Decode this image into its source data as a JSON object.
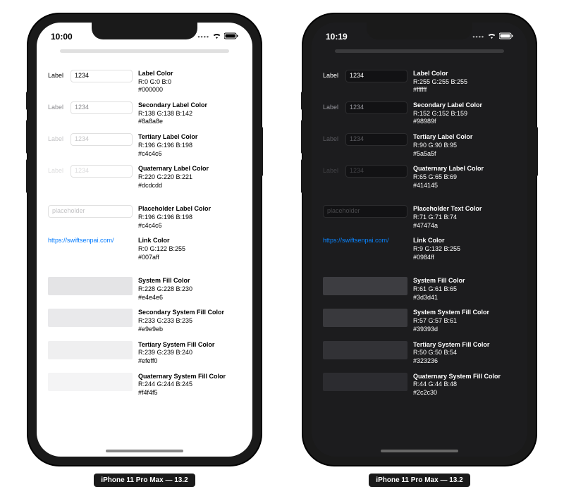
{
  "caption": "iPhone 11 Pro Max — 13.2",
  "link_url": "https://swiftsenpai.com/",
  "light": {
    "time": "10:00",
    "label_text": "Label",
    "field_value": "1234",
    "placeholder": "placeholder",
    "rows": [
      {
        "name": "Label Color",
        "rgb": "R:0 G:0 B:0",
        "hex": "#000000",
        "color": "#000000"
      },
      {
        "name": "Secondary Label Color",
        "rgb": "R:138 G:138 B:142",
        "hex": "#8a8a8e",
        "color": "#8a8a8e"
      },
      {
        "name": "Tertiary Label Color",
        "rgb": "R:196 G:196 B:198",
        "hex": "#c4c4c6",
        "color": "#c4c4c6"
      },
      {
        "name": "Quaternary Label Color",
        "rgb": "R:220 G:220 B:221",
        "hex": "#dcdcdd",
        "color": "#dcdcdd"
      }
    ],
    "placeholder_row": {
      "name": "Placeholder Label Color",
      "rgb": "R:196 G:196 B:198",
      "hex": "#c4c4c6",
      "color": "#c4c4c6"
    },
    "link_row": {
      "name": "Link Color",
      "rgb": "R:0 G:122 B:255",
      "hex": "#007aff",
      "color": "#007aff"
    },
    "fills": [
      {
        "name": "System Fill Color",
        "rgb": "R:228 G:228 B:230",
        "hex": "#e4e4e6",
        "color": "#e4e4e6"
      },
      {
        "name": "Secondary System Fill Color",
        "rgb": "R:233 G:233 B:235",
        "hex": "#e9e9eb",
        "color": "#e9e9eb"
      },
      {
        "name": "Tertiary System Fill Color",
        "rgb": "R:239 G:239 B:240",
        "hex": "#efeff0",
        "color": "#efeff0"
      },
      {
        "name": "Quaternary System Fill Color",
        "rgb": "R:244 G:244 B:245",
        "hex": "#f4f4f5",
        "color": "#f4f4f5"
      }
    ]
  },
  "dark": {
    "time": "10:19",
    "label_text": "Label",
    "field_value": "1234",
    "placeholder": "placeholder",
    "rows": [
      {
        "name": "Label Color",
        "rgb": "R:255 G:255 B:255",
        "hex": "#ffffff",
        "color": "#ffffff"
      },
      {
        "name": "Secondary Label Color",
        "rgb": "R:152 G:152 B:159",
        "hex": "#98989f",
        "color": "#98989f"
      },
      {
        "name": "Tertiary Label Color",
        "rgb": "R:90 G:90 B:95",
        "hex": "#5a5a5f",
        "color": "#5a5a5f"
      },
      {
        "name": "Quaternary Label Color",
        "rgb": "R:65 G:65 B:69",
        "hex": "#414145",
        "color": "#414145"
      }
    ],
    "placeholder_row": {
      "name": "Placeholder Text Color",
      "rgb": "R:71 G:71 B:74",
      "hex": "#47474a",
      "color": "#47474a"
    },
    "link_row": {
      "name": "Link Color",
      "rgb": "R:9 G:132 B:255",
      "hex": "#0984ff",
      "color": "#0984ff"
    },
    "fills": [
      {
        "name": "System Fill Color",
        "rgb": "R:61 G:61 B:65",
        "hex": "#3d3d41",
        "color": "#3d3d41"
      },
      {
        "name": "System System Fill Color",
        "rgb": "R:57 G:57 B:61",
        "hex": "#39393d",
        "color": "#39393d"
      },
      {
        "name": "Tertiary System Fill Color",
        "rgb": "R:50 G:50 B:54",
        "hex": "#323236",
        "color": "#323236"
      },
      {
        "name": "Quaternary System Fill Color",
        "rgb": "R:44 G:44 B:48",
        "hex": "#2c2c30",
        "color": "#2c2c30"
      }
    ]
  }
}
